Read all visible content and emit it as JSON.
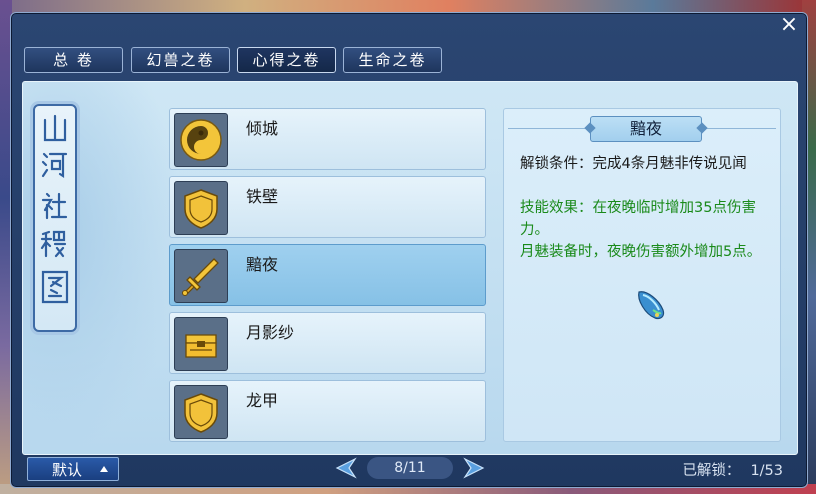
{
  "window": {
    "close_label": "×"
  },
  "tabs": [
    {
      "label": "总 卷",
      "active": false
    },
    {
      "label": "幻兽之卷",
      "active": false
    },
    {
      "label": "心得之卷",
      "active": true
    },
    {
      "label": "生命之卷",
      "active": false
    }
  ],
  "scroll_title": "山河社稷图",
  "list": [
    {
      "name": "倾城",
      "icon": "yin-yang-icon",
      "selected": false
    },
    {
      "name": "铁壁",
      "icon": "shield-icon",
      "selected": false
    },
    {
      "name": "黯夜",
      "icon": "sword-icon",
      "selected": true
    },
    {
      "name": "月影纱",
      "icon": "treasure-chest-icon",
      "selected": false
    },
    {
      "name": "龙甲",
      "icon": "shield-icon",
      "selected": false
    }
  ],
  "detail": {
    "title": "黯夜",
    "unlock_condition": "解锁条件：完成4条月魅非传说见闻",
    "effect_1": "技能效果：在夜晚临时增加35点伤害力。",
    "effect_2": "月魅装备时，夜晚伤害额外增加5点。",
    "item_icon": "moon-gem-icon"
  },
  "footer": {
    "sort_label": "默认",
    "page": "8/11",
    "unlocked_label": "已解锁：",
    "unlocked_value": "1/53"
  },
  "colors": {
    "frame": "#2b4672",
    "panel": "#cfe7f5",
    "selected": "#9fd0ef",
    "effect_text": "#1a8a1a"
  }
}
